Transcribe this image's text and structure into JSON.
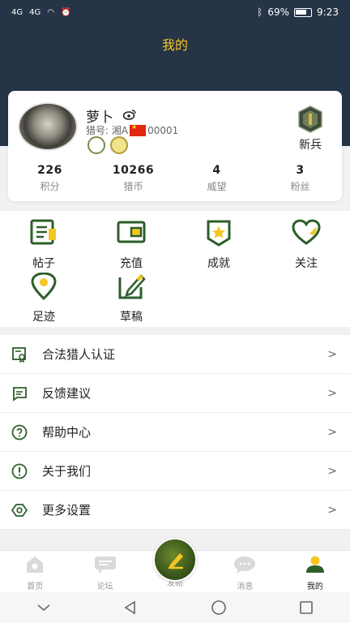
{
  "status": {
    "battery": "69%",
    "time": "9:23",
    "net1": "4G",
    "net2": "4G"
  },
  "header": {
    "title": "我的"
  },
  "profile": {
    "nickname": "萝卜",
    "hunter_no_prefix": "猎号: 湘A",
    "hunter_no_suffix": "00001",
    "rank": "新兵",
    "stats": [
      {
        "value": "226",
        "label": "积分"
      },
      {
        "value": "10266",
        "label": "猎币"
      },
      {
        "value": "4",
        "label": "威望"
      },
      {
        "value": "3",
        "label": "粉丝"
      }
    ]
  },
  "features": [
    {
      "label": "帖子",
      "icon": "post-icon"
    },
    {
      "label": "充值",
      "icon": "wallet-icon"
    },
    {
      "label": "成就",
      "icon": "star-badge-icon"
    },
    {
      "label": "关注",
      "icon": "heart-icon"
    },
    {
      "label": "足迹",
      "icon": "location-icon"
    },
    {
      "label": "草稿",
      "icon": "edit-icon"
    }
  ],
  "menu": [
    {
      "label": "合法猎人认证",
      "icon": "certificate-icon"
    },
    {
      "label": "反馈建议",
      "icon": "feedback-icon"
    },
    {
      "label": "帮助中心",
      "icon": "help-icon"
    },
    {
      "label": "关于我们",
      "icon": "info-icon"
    },
    {
      "label": "更多设置",
      "icon": "settings-icon"
    }
  ],
  "menu_arrow": ">",
  "tabs": [
    {
      "label": "首页",
      "icon": "home-icon"
    },
    {
      "label": "论坛",
      "icon": "forum-icon"
    },
    {
      "label": "发帖",
      "icon": "compose-icon"
    },
    {
      "label": "消息",
      "icon": "message-icon"
    },
    {
      "label": "我的",
      "icon": "profile-icon"
    }
  ],
  "colors": {
    "header_bg": "#253447",
    "accent_green": "#2d5f2a",
    "accent_yellow": "#f3c623"
  }
}
